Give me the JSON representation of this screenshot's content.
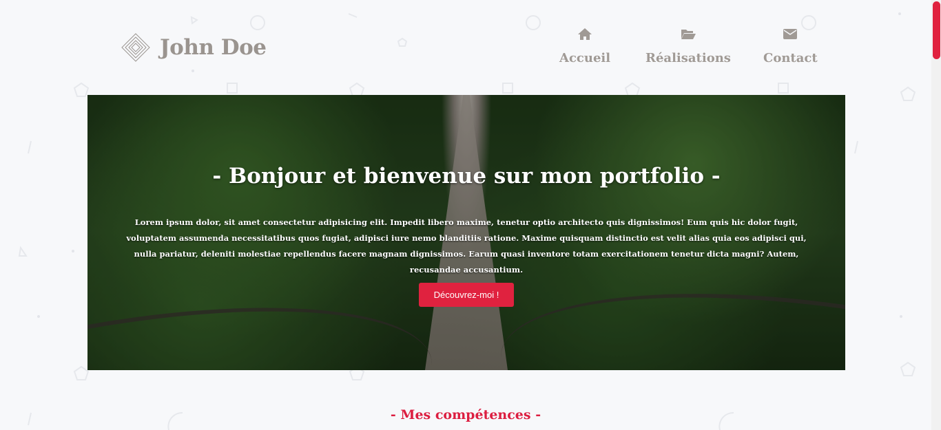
{
  "header": {
    "logo_title": "John Doe",
    "nav": [
      {
        "label": "Accueil",
        "icon": "home-icon"
      },
      {
        "label": "Réalisations",
        "icon": "folder-open-icon"
      },
      {
        "label": "Contact",
        "icon": "envelope-icon"
      }
    ]
  },
  "hero": {
    "title": "- Bonjour et bienvenue sur mon portfolio -",
    "text": "Lorem ipsum dolor, sit amet consectetur adipisicing elit. Impedit libero maxime, tenetur optio architecto quis dignissimos! Eum quis hic dolor fugit, voluptatem assumenda necessitatibus quos fugiat, adipisci iure nemo blanditiis ratione. Maxime quisquam distinctio est velit alias quia eos adipisci qui, nulla pariatur, deleniti molestiae repellendus facere magnam dignissimos. Earum quasi inventore totam exercitationem tenetur dicta magni? Autem, recusandae accusantium.",
    "button": "Découvrez-moi !"
  },
  "skills": {
    "title": "- Mes compétences -"
  },
  "colors": {
    "accent": "#e0223f",
    "nav": "#a09a95",
    "background": "#f7f8fa"
  }
}
